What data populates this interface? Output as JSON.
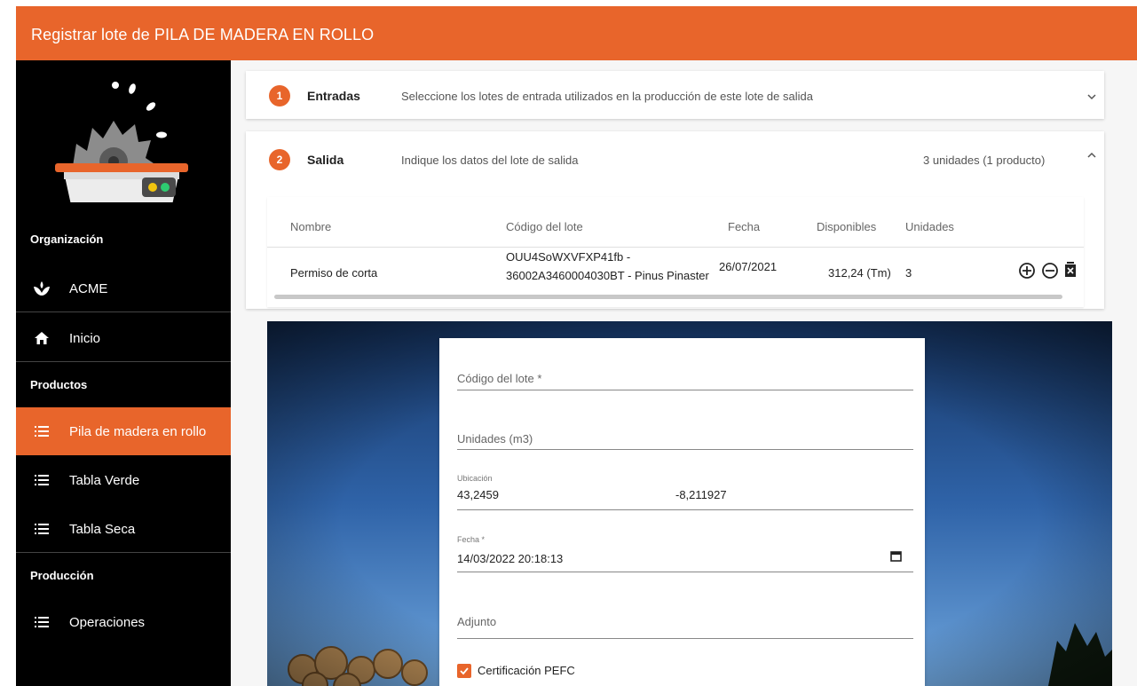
{
  "header": {
    "title": "Registrar lote de PILA DE MADERA EN ROLLO"
  },
  "sidebar": {
    "logo_icon": "sawmill-logo",
    "org_label": "Organización",
    "org_name": "ACME",
    "home_label": "Inicio",
    "products_label": "Productos",
    "products": [
      {
        "label": "Pila de madera en rollo",
        "active": true
      },
      {
        "label": "Tabla Verde",
        "active": false
      },
      {
        "label": "Tabla Seca",
        "active": false
      }
    ],
    "production_label": "Producción",
    "production": [
      {
        "label": "Operaciones"
      }
    ]
  },
  "steps": {
    "inputs": {
      "number": "1",
      "title": "Entradas",
      "description": "Seleccione los lotes de entrada utilizados en la producción de este lote de salida"
    },
    "output": {
      "number": "2",
      "title": "Salida",
      "description": "Indique los datos del lote de salida",
      "summary": "3 unidades (1 producto)"
    }
  },
  "table": {
    "headers": [
      "Nombre",
      "Código del lote",
      "Fecha",
      "Disponibles",
      "Unidades"
    ],
    "rows": [
      {
        "name": "Permiso de corta",
        "code_line1": "OUU4SoWXVFXP41fb -",
        "code_line2": "36002A3460004030BT - Pinus Pinaster",
        "date": "26/07/2021",
        "available": "312,24 (Tm)",
        "units": "3"
      }
    ]
  },
  "form": {
    "lot_code_placeholder": "Código del lote *",
    "units_placeholder": "Unidades (m3)",
    "location_label": "Ubicación",
    "latitude": "43,2459",
    "longitude": "-8,211927",
    "date_label": "Fecha *",
    "date_value": "14/03/2022 20:18:13",
    "attachment_placeholder": "Adjunto",
    "pefc_label": "Certificación PEFC",
    "pefc_checked": true
  },
  "colors": {
    "accent": "#e8652b",
    "sidebar": "#000000"
  }
}
